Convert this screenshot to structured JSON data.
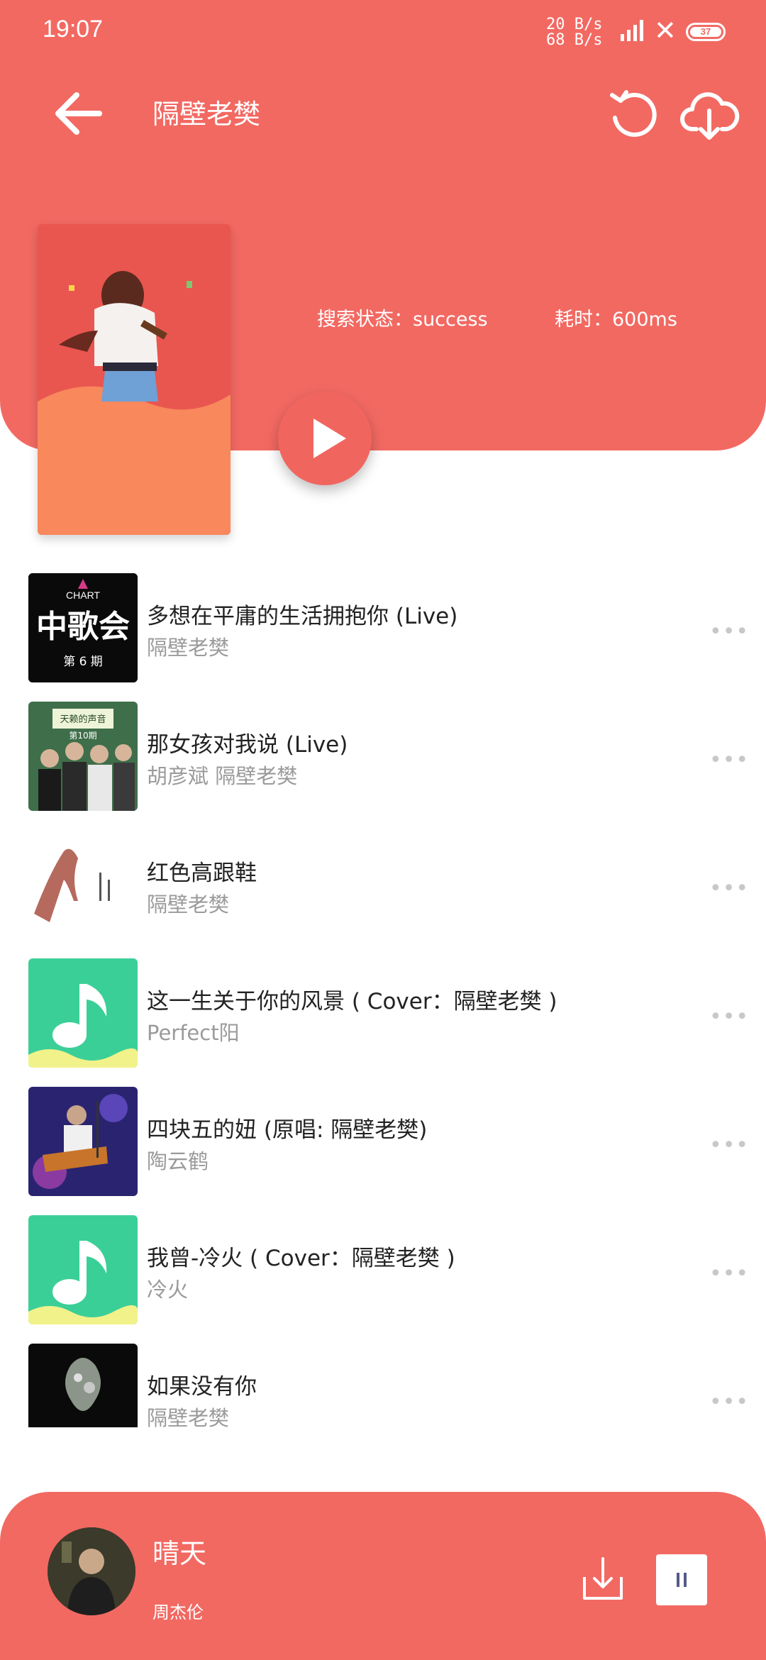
{
  "status_bar": {
    "time": "19:07",
    "net_up": "20 B/s",
    "net_down": "68 B/s",
    "battery": "37"
  },
  "header": {
    "title": "隔壁老樊",
    "search_status": "搜索状态：success",
    "elapsed": "耗时：600ms"
  },
  "songs": [
    {
      "title": "多想在平庸的生活拥抱你 (Live)",
      "artist": "隔壁老樊",
      "thumb": "zhonggehui"
    },
    {
      "title": "那女孩对我说 (Live)",
      "artist": "胡彦斌  隔壁老樊",
      "thumb": "tianlai"
    },
    {
      "title": "红色高跟鞋",
      "artist": "隔壁老樊",
      "thumb": "heel"
    },
    {
      "title": "这一生关于你的风景 ( Cover：隔壁老樊 )",
      "artist": "Perfect阳",
      "thumb": "music-note"
    },
    {
      "title": "四块五的妞 (原唱: 隔壁老樊)",
      "artist": "陶云鹤",
      "thumb": "guitar"
    },
    {
      "title": "我曾-冷火 ( Cover：隔壁老樊 )",
      "artist": "冷火",
      "thumb": "music-note"
    },
    {
      "title": "如果没有你",
      "artist": "隔壁老樊",
      "thumb": "dark"
    }
  ],
  "thumb_text": {
    "chart_small": "CHART",
    "zhonggehui": "中歌会",
    "episode6": "第 6 期",
    "tianlai": "天赖的声音",
    "episode10": "第10期"
  },
  "player": {
    "title": "晴天",
    "artist": "周杰伦"
  },
  "more_label": "•••",
  "colors": {
    "accent": "#f26962",
    "note_green": "#3bcf98"
  }
}
